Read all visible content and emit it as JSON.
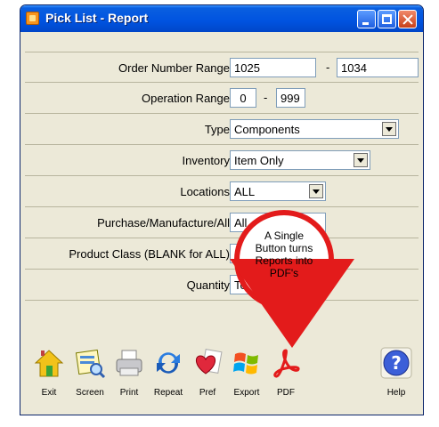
{
  "window": {
    "title": "Pick List - Report"
  },
  "form": {
    "order_number_range": {
      "label": "Order Number Range",
      "from": "1025",
      "sep": "-",
      "to": "1034"
    },
    "operation_range": {
      "label": "Operation Range",
      "from": "0",
      "sep": "-",
      "to": "999"
    },
    "type": {
      "label": "Type",
      "value": "Components"
    },
    "inventory": {
      "label": "Inventory",
      "value": "Item Only"
    },
    "locations": {
      "label": "Locations",
      "value": "ALL"
    },
    "purchase_manufacture": {
      "label": "Purchase/Manufacture/All",
      "value": "All"
    },
    "product_class": {
      "label": "Product Class (BLANK for ALL)",
      "value": ""
    },
    "quantity": {
      "label": "Quantity",
      "value": "Total"
    }
  },
  "toolbar": {
    "exit": "Exit",
    "screen": "Screen",
    "print": "Print",
    "repeat": "Repeat",
    "pref": "Pref",
    "export": "Export",
    "pdf": "PDF",
    "help": "Help"
  },
  "callout": {
    "text": "A Single Button turns Reports into PDF's",
    "color": "#e31b1b"
  }
}
